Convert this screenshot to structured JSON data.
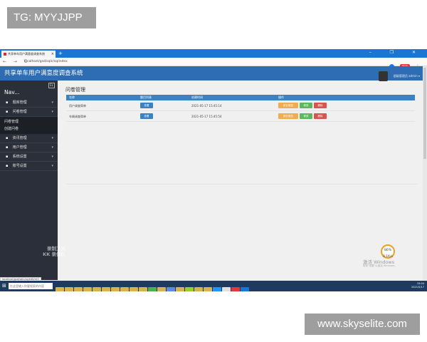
{
  "watermarks": {
    "top": "TG: MYYJJPP",
    "bottom": "www.skyselite.com",
    "recorder": "录制工具\nKK 录像机",
    "win_activate": "激活 Windows",
    "win_activate_sub": "转到\"设置\"以激活 Windows。",
    "gauge": "86%\n0.1K/s"
  },
  "browser": {
    "tab_title": "共享单车用户满意度调查系统",
    "tab_close": "×",
    "new_tab": "+",
    "window_buttons": "– ❐ ✕",
    "nav_buttons": "← → C",
    "url": "localhost/gsd/sqlc/sq/index",
    "pause_label": "暂停",
    "menu": "⋮",
    "status_url": "localhost/gsd/sqlc/sq/edit/id/1"
  },
  "app": {
    "title": "共享单车用户满意度调查系统",
    "user_name": "超级管理员 admin ▾",
    "nav_title": "Nav...",
    "collapse_icon": "EL"
  },
  "sidebar": {
    "items": [
      {
        "label": "题库管理",
        "icon": "▪",
        "chevron": "▾"
      },
      {
        "label": "问卷管理",
        "icon": "▪",
        "chevron": "▾"
      }
    ],
    "sub_items": [
      {
        "label": "问卷管理"
      },
      {
        "label": "创建问卷"
      }
    ],
    "items_after": [
      {
        "label": "资讯管理",
        "icon": "▪",
        "chevron": "▾"
      },
      {
        "label": "用户管理",
        "icon": "▪",
        "chevron": "▾"
      },
      {
        "label": "系统设置",
        "icon": "▪",
        "chevron": "▾"
      },
      {
        "label": "账号设置",
        "icon": "▪",
        "chevron": "▾"
      }
    ]
  },
  "main": {
    "page_title": "问卷管理",
    "columns": [
      "名称",
      "题目列表",
      "创建时间",
      "操作"
    ],
    "rows": [
      {
        "name": "用户调查简单",
        "view_btn": "查看",
        "created": "2021-05-17 15:45:14",
        "actions": [
          "统计报告",
          "修改",
          "删除"
        ]
      },
      {
        "name": "车辆调查简单",
        "view_btn": "查看",
        "created": "2021-05-17 15:45:54",
        "actions": [
          "统计报告",
          "修改",
          "删除"
        ]
      }
    ]
  },
  "taskbar": {
    "start": "⊞",
    "search": "在这里输入你要搜索的内容",
    "clock_time": "15:04",
    "clock_date": "2021/5/17"
  },
  "colors": {
    "header": "#2e6db4",
    "sidebar": "#2b2f3a",
    "table_head": "#3a82c4",
    "orange": "#f0ad4e",
    "green": "#5cb85c",
    "red": "#d9534f"
  }
}
